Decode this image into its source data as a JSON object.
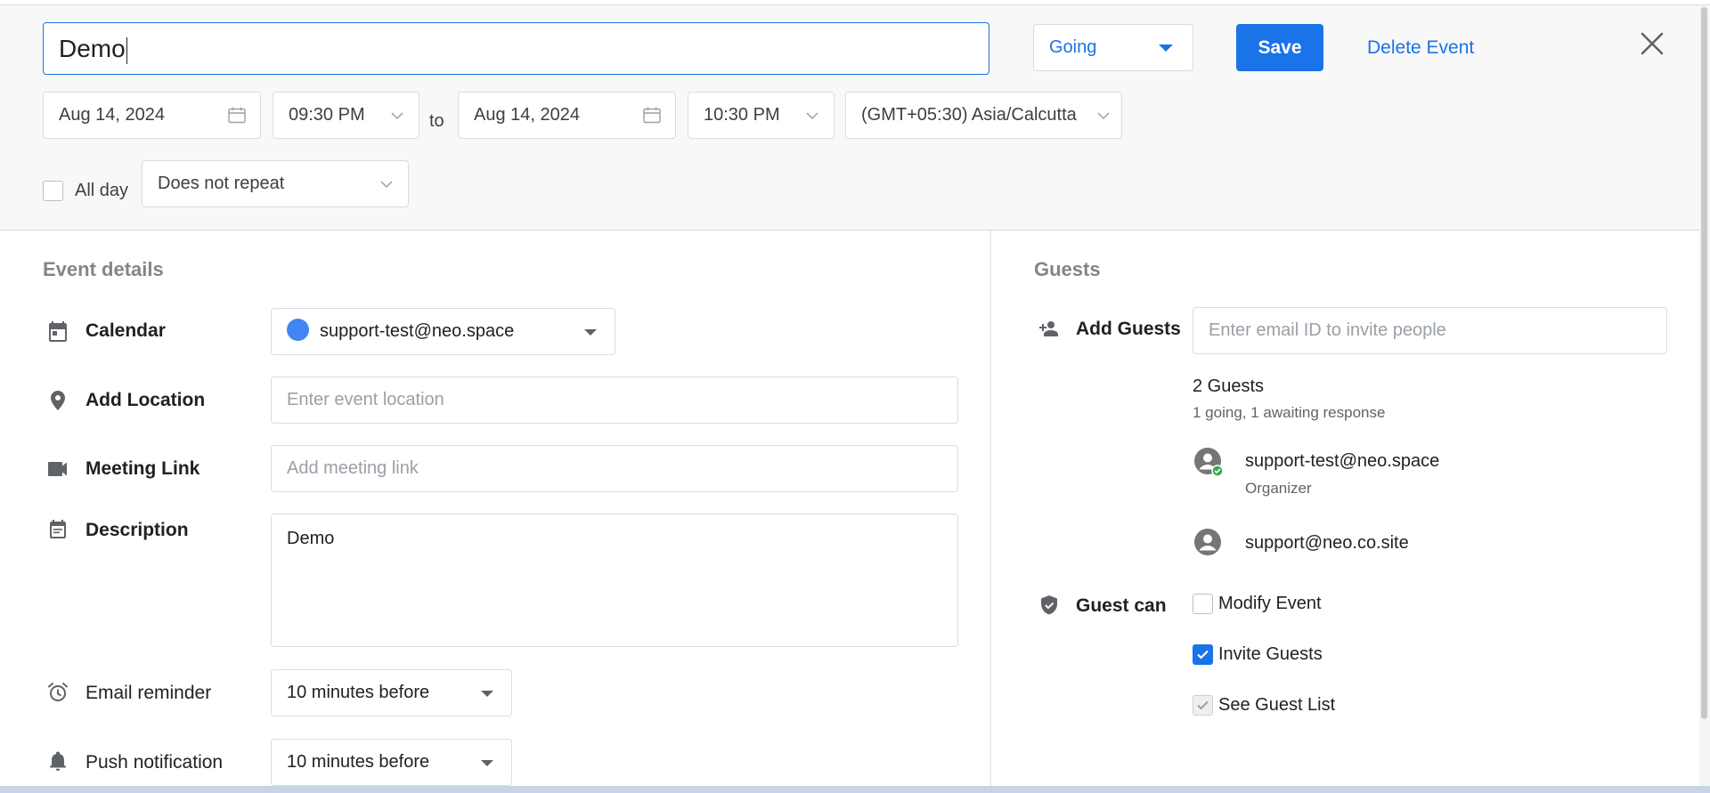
{
  "header": {
    "title_value": "Demo",
    "rsvp": {
      "selected": "Going"
    },
    "save_label": "Save",
    "delete_label": "Delete Event",
    "start_date": "Aug 14, 2024",
    "start_time": "09:30 PM",
    "to_label": "to",
    "end_date": "Aug 14, 2024",
    "end_time": "10:30 PM",
    "timezone": "(GMT+05:30) Asia/Calcutta",
    "all_day_label": "All day",
    "all_day_checked": false,
    "repeat": "Does not repeat"
  },
  "event_details": {
    "section_title": "Event details",
    "calendar_label": "Calendar",
    "calendar_value": "support-test@neo.space",
    "calendar_color": "#4285f4",
    "location_label": "Add Location",
    "location_placeholder": "Enter event location",
    "meeting_label": "Meeting Link",
    "meeting_placeholder": "Add meeting link",
    "description_label": "Description",
    "description_value": "Demo",
    "email_reminder_label": "Email reminder",
    "email_reminder_value": "10 minutes before",
    "push_label": "Push notification",
    "push_value": "10 minutes before"
  },
  "guests": {
    "section_title": "Guests",
    "add_label": "Add Guests",
    "add_placeholder": "Enter email ID to invite people",
    "count_text": "2 Guests",
    "summary_text": "1 going, 1 awaiting response",
    "list": [
      {
        "email": "support-test@neo.space",
        "role": "Organizer",
        "status": "going"
      },
      {
        "email": "support@neo.co.site",
        "role": "",
        "status": "awaiting"
      }
    ],
    "guest_can_label": "Guest can",
    "permissions": [
      {
        "label": "Modify Event",
        "checked": false,
        "disabled": false
      },
      {
        "label": "Invite Guests",
        "checked": true,
        "disabled": false
      },
      {
        "label": "See Guest List",
        "checked": true,
        "disabled": true
      }
    ]
  },
  "colors": {
    "accent": "#1a73e8",
    "status_going": "#34a853"
  }
}
